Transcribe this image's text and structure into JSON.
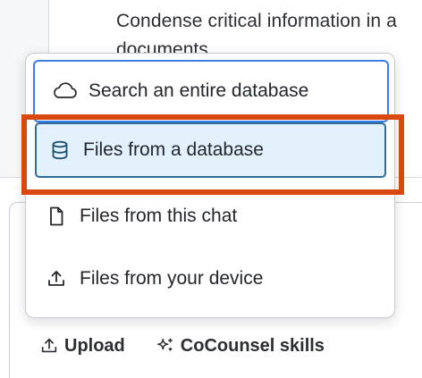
{
  "background": {
    "text_line1": "Condense critical information in a",
    "text_line2": "documents."
  },
  "menu": {
    "items": [
      {
        "label": "Search an entire database",
        "icon": "cloud-icon"
      },
      {
        "label": "Files from a database",
        "icon": "database-icon"
      },
      {
        "label": "Files from this chat",
        "icon": "file-icon"
      },
      {
        "label": "Files from your device",
        "icon": "upload-icon"
      }
    ]
  },
  "toolbar": {
    "upload_label": "Upload",
    "skills_label": "CoCounsel skills"
  },
  "colors": {
    "focus_border": "#3a7be8",
    "selected_bg": "#e3f1fd",
    "selected_border": "#2f6c96",
    "highlight": "#d9480f"
  }
}
